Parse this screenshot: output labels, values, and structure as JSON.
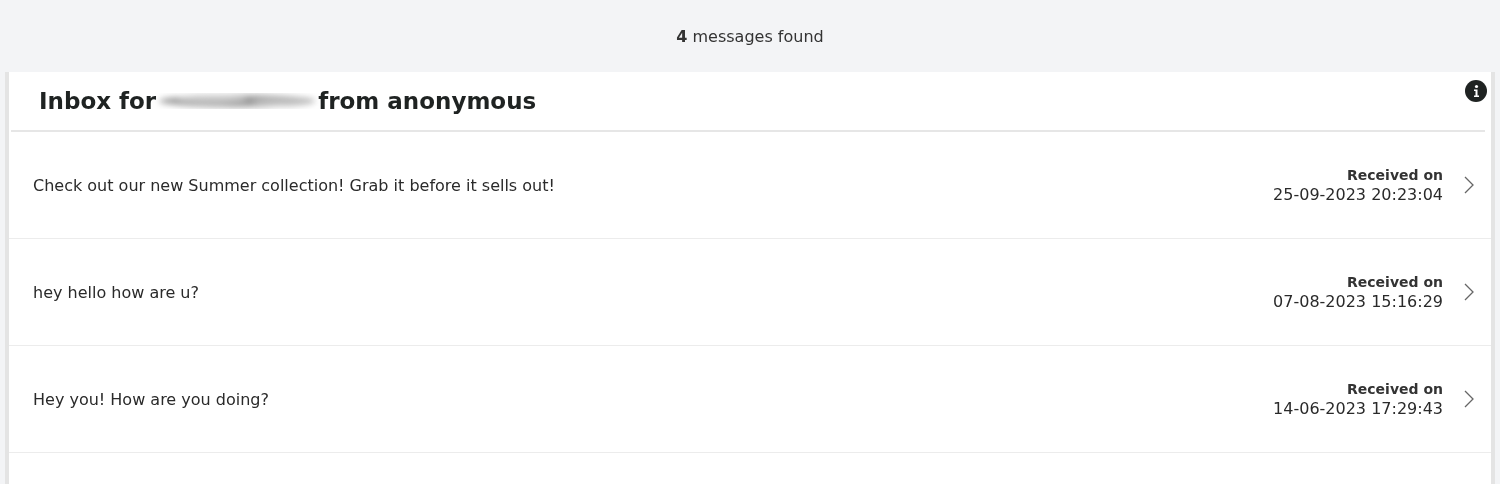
{
  "summary": "**4** messages found",
  "inbox": {
    "title_prefix": "Inbox for",
    "title_suffix": "from anonymous",
    "redacted": true
  },
  "messages": [
    {
      "text": "Check out our new Summer collection! Grab it before it sells out!",
      "received_label": "Received on",
      "received_at": "25-09-2023 20:23:04"
    },
    {
      "text": "hey hello how are u?",
      "received_label": "Received on",
      "received_at": "07-08-2023 15:16:29"
    },
    {
      "text": "Hey you! How are you doing?",
      "received_label": "Received on",
      "received_at": "14-06-2023 17:29:43"
    }
  ]
}
